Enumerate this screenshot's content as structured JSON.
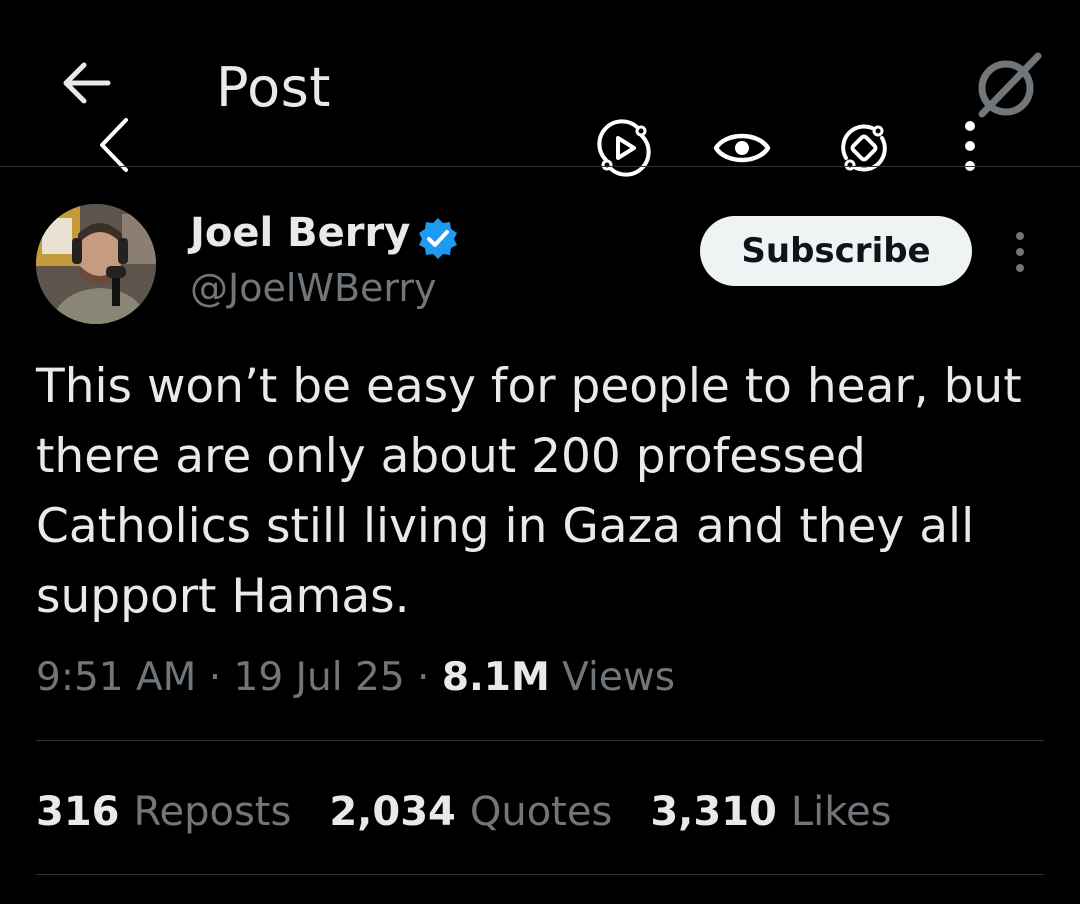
{
  "header": {
    "title": "Post",
    "back_icon": "arrow-left-icon",
    "grok_icon": "grok-icon"
  },
  "overlay_toolbar": {
    "back_icon": "chevron-left-icon",
    "play_icon": "play-rotate-icon",
    "eye_icon": "eye-icon",
    "rotate_icon": "rotate-icon",
    "more_icon": "more-vertical-icon"
  },
  "author": {
    "name": "Joel Berry",
    "handle": "@JoelWBerry",
    "verified": true,
    "verified_color": "#1d9bf0",
    "subscribe_label": "Subscribe"
  },
  "post": {
    "text": "This won’t be easy for people to hear, but there are only about 200 professed Catholics still living in Gaza and they all support Hamas.",
    "time": "9:51 AM",
    "date": "19 Jul 25",
    "views_count": "8.1M",
    "views_label": "Views",
    "separator": "·"
  },
  "stats": [
    {
      "count": "316",
      "label": "Reposts"
    },
    {
      "count": "2,034",
      "label": "Quotes"
    },
    {
      "count": "3,310",
      "label": "Likes"
    }
  ],
  "colors": {
    "background": "#000000",
    "primary_text": "#e7e9ea",
    "secondary_text": "#71767b",
    "divider": "#2f3336",
    "button_bg": "#eff3f4",
    "button_text": "#0f1419"
  }
}
